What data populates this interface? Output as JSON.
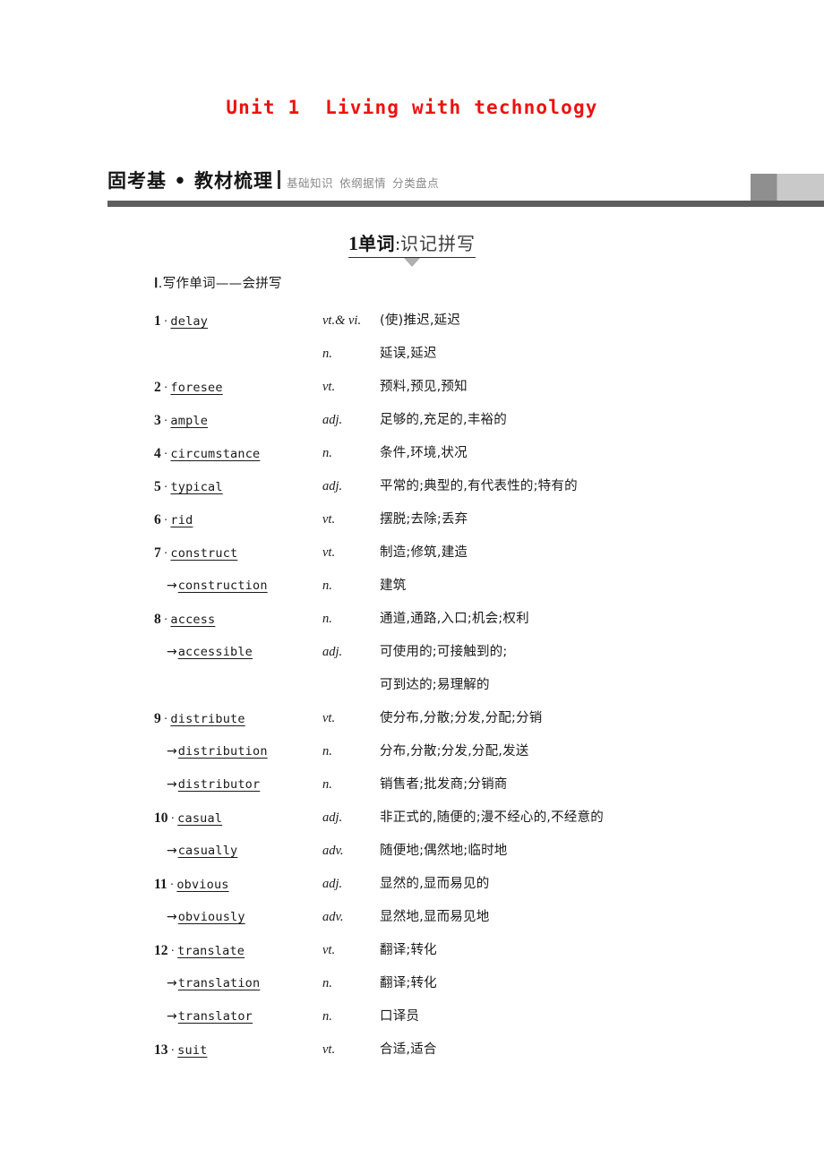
{
  "unit": {
    "title": "Unit 1  Living with technology",
    "title_color": "#ee1111"
  },
  "header": {
    "main_title": "固考基 • 教材梳理",
    "sub_items": [
      "基础知识",
      "依纲据情",
      "分类盘点"
    ],
    "rule_color": "#5e5e5e",
    "block_dark": "#8f8f8f",
    "block_light": "#c9c9c9"
  },
  "subsection": {
    "number": "1",
    "label_a": "单词",
    "colon": ":",
    "label_b": "识记拼写"
  },
  "part": {
    "roman": "Ⅰ",
    "heading": ".写作单词——会拼写"
  },
  "entries": [
    {
      "num": "1",
      "sep": "·",
      "word": "delay",
      "derived": false,
      "pos": "vt.& vi.",
      "def": "(使)推迟,延迟"
    },
    {
      "num": "",
      "sep": "",
      "word": "",
      "derived": false,
      "pos": "n.",
      "def": "延误,延迟"
    },
    {
      "num": "2",
      "sep": "·",
      "word": "foresee",
      "derived": false,
      "pos": "vt.",
      "def": "预料,预见,预知"
    },
    {
      "num": "3",
      "sep": "·",
      "word": "ample",
      "derived": false,
      "pos": "adj.",
      "def": "足够的,充足的,丰裕的"
    },
    {
      "num": "4",
      "sep": "·",
      "word": "circumstance",
      "derived": false,
      "pos": "n.",
      "def": "条件,环境,状况"
    },
    {
      "num": "5",
      "sep": "·",
      "word": "typical",
      "derived": false,
      "pos": "adj.",
      "def": "平常的;典型的,有代表性的;特有的"
    },
    {
      "num": "6",
      "sep": "·",
      "word": "rid",
      "derived": false,
      "pos": "vt.",
      "def": "摆脱;去除;丢弃"
    },
    {
      "num": "7",
      "sep": "·",
      "word": "construct",
      "derived": false,
      "pos": "vt.",
      "def": "制造;修筑,建造"
    },
    {
      "num": "",
      "sep": "→",
      "word": "construction",
      "derived": true,
      "pos": "n.",
      "def": "建筑"
    },
    {
      "num": "8",
      "sep": "·",
      "word": "access",
      "derived": false,
      "pos": "n.",
      "def": "通道,通路,入口;机会;权利"
    },
    {
      "num": "",
      "sep": "→",
      "word": "accessible",
      "derived": true,
      "pos": "adj.",
      "def": "可使用的;可接触到的;"
    },
    {
      "num": "",
      "sep": "",
      "word": "",
      "derived": false,
      "pos": "",
      "def": "可到达的;易理解的"
    },
    {
      "num": "9",
      "sep": "·",
      "word": "distribute",
      "derived": false,
      "pos": "vt.",
      "def": "使分布,分散;分发,分配;分销"
    },
    {
      "num": "",
      "sep": "→",
      "word": "distribution",
      "derived": true,
      "pos": "n.",
      "def": "分布,分散;分发,分配,发送"
    },
    {
      "num": "",
      "sep": "→",
      "word": "distributor",
      "derived": true,
      "pos": "n.",
      "def": "销售者;批发商;分销商"
    },
    {
      "num": "10",
      "sep": "·",
      "word": "casual",
      "derived": false,
      "pos": "adj.",
      "def": "非正式的,随便的;漫不经心的,不经意的"
    },
    {
      "num": "",
      "sep": "→",
      "word": "casually",
      "derived": true,
      "pos": "adv.",
      "def": "随便地;偶然地;临时地"
    },
    {
      "num": "11",
      "sep": "·",
      "word": "obvious",
      "derived": false,
      "pos": "adj.",
      "def": "显然的,显而易见的"
    },
    {
      "num": "",
      "sep": "→",
      "word": "obviously",
      "derived": true,
      "pos": "adv.",
      "def": "显然地,显而易见地"
    },
    {
      "num": "12",
      "sep": "·",
      "word": "translate",
      "derived": false,
      "pos": "vt.",
      "def": "翻译;转化"
    },
    {
      "num": "",
      "sep": "→",
      "word": "translation",
      "derived": true,
      "pos": "n.",
      "def": "翻译;转化"
    },
    {
      "num": "",
      "sep": "→",
      "word": "translator",
      "derived": true,
      "pos": "n.",
      "def": "口译员"
    },
    {
      "num": "13",
      "sep": "·",
      "word": "suit",
      "derived": false,
      "pos": "vt.",
      "def": "合适,适合"
    }
  ]
}
